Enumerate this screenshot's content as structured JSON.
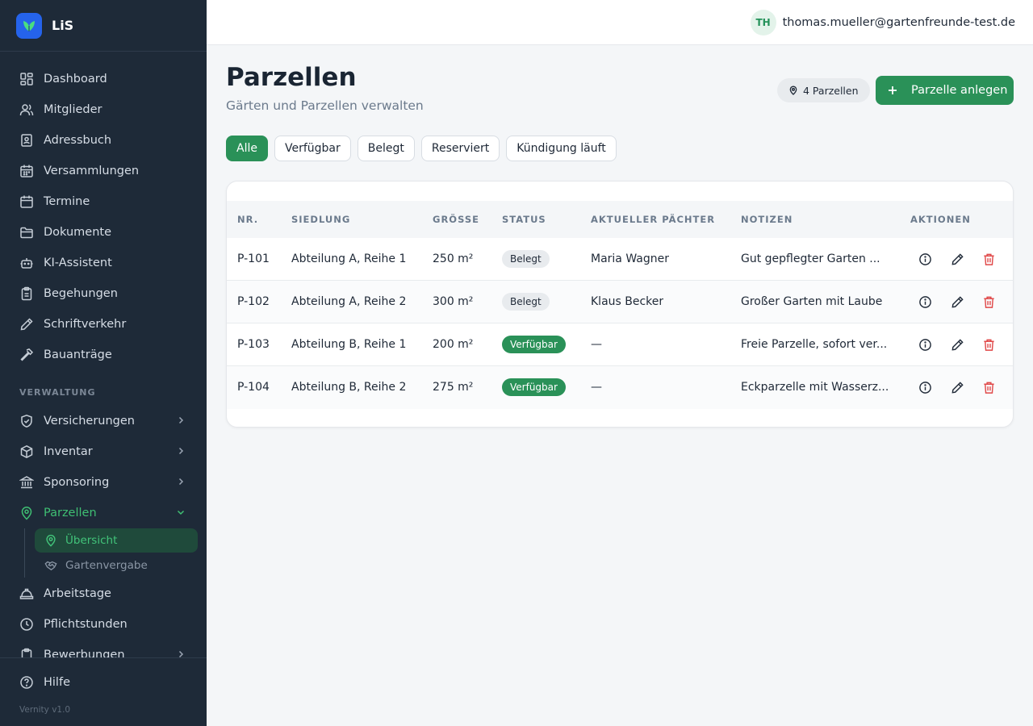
{
  "app": {
    "name": "LiS",
    "version": "Vernity v1.0"
  },
  "colors": {
    "accent": "#2a9158",
    "sidebar_bg": "#1e2a38",
    "active_nav": "#3fbf73",
    "delete": "#e04848"
  },
  "sidebar": {
    "items": [
      {
        "label": "Dashboard",
        "icon": "dashboard-icon"
      },
      {
        "label": "Mitglieder",
        "icon": "users-icon"
      },
      {
        "label": "Adressbuch",
        "icon": "address-book-icon"
      },
      {
        "label": "Versammlungen",
        "icon": "calendar-grid-icon"
      },
      {
        "label": "Termine",
        "icon": "calendar-icon"
      },
      {
        "label": "Dokumente",
        "icon": "folder-icon"
      },
      {
        "label": "KI-Assistent",
        "icon": "bot-icon"
      },
      {
        "label": "Begehungen",
        "icon": "clipboard-icon"
      },
      {
        "label": "Schriftverkehr",
        "icon": "pen-icon"
      },
      {
        "label": "Bauanträge",
        "icon": "hammer-icon"
      }
    ],
    "section_label": "VERWALTUNG",
    "admin_items": [
      {
        "label": "Versicherungen",
        "icon": "shield-icon"
      },
      {
        "label": "Inventar",
        "icon": "box-icon"
      },
      {
        "label": "Sponsoring",
        "icon": "bank-icon"
      },
      {
        "label": "Parzellen",
        "icon": "map-pin-icon"
      }
    ],
    "sub_items": [
      {
        "label": "Übersicht",
        "icon": "map-pin-icon"
      },
      {
        "label": "Gartenvergabe",
        "icon": "handshake-icon"
      }
    ],
    "after_items": [
      {
        "label": "Arbeitstage",
        "icon": "hard-hat-icon"
      },
      {
        "label": "Pflichtstunden",
        "icon": "clock-icon"
      },
      {
        "label": "Bewerbungen",
        "icon": "clipboard-icon"
      }
    ],
    "help_label": "Hilfe"
  },
  "header": {
    "avatar_initials": "TH",
    "email": "thomas.mueller@gartenfreunde-test.de"
  },
  "page": {
    "title": "Parzellen",
    "subtitle": "Gärten und Parzellen verwalten",
    "count_badge": "4 Parzellen",
    "add_button": "Parzelle anlegen"
  },
  "filters": [
    "Alle",
    "Verfügbar",
    "Belegt",
    "Reserviert",
    "Kündigung läuft"
  ],
  "table": {
    "columns": [
      "NR.",
      "SIEDLUNG",
      "GRÖSSE",
      "STATUS",
      "AKTUELLER PÄCHTER",
      "NOTIZEN",
      "AKTIONEN"
    ],
    "rows": [
      {
        "nr": "P-101",
        "siedlung": "Abteilung A, Reihe 1",
        "groesse": "250 m²",
        "status": "Belegt",
        "paechter": "Maria Wagner",
        "notizen": "Gut gepflegter Garten ..."
      },
      {
        "nr": "P-102",
        "siedlung": "Abteilung A, Reihe 2",
        "groesse": "300 m²",
        "status": "Belegt",
        "paechter": "Klaus Becker",
        "notizen": "Großer Garten mit Laube"
      },
      {
        "nr": "P-103",
        "siedlung": "Abteilung B, Reihe 1",
        "groesse": "200 m²",
        "status": "Verfügbar",
        "paechter": "—",
        "notizen": "Freie Parzelle, sofort ver..."
      },
      {
        "nr": "P-104",
        "siedlung": "Abteilung B, Reihe 2",
        "groesse": "275 m²",
        "status": "Verfügbar",
        "paechter": "—",
        "notizen": "Eckparzelle mit Wasserz..."
      }
    ]
  }
}
